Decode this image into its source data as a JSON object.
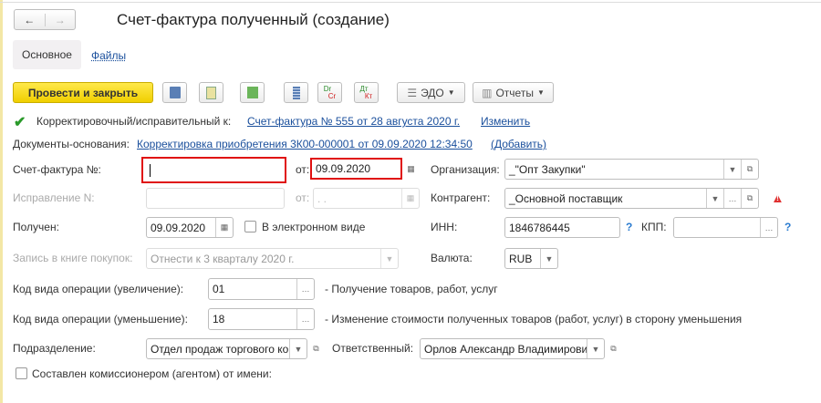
{
  "window": {
    "title": "Счет-фактура полученный (создание)"
  },
  "nav": {
    "back": "←",
    "forward": "→"
  },
  "tabs": [
    {
      "label": "Основное",
      "active": true
    },
    {
      "label": "Файлы",
      "active": false
    }
  ],
  "toolbar": {
    "post_close": "Провести и закрыть",
    "edo": "ЭДО",
    "reports": "Отчеты",
    "dr": "Dr",
    "cr": "Cr",
    "dt": "Дт",
    "kt": "Кт",
    "accent": "#f5d800"
  },
  "correction": {
    "checked": true,
    "label": "Корректировочный/исправительный к:",
    "link": "Счет-фактура № 555 от 28 августа 2020 г.",
    "change": "Изменить"
  },
  "base_docs": {
    "label": "Документы-основания:",
    "link": "Корректировка приобретения 3К00-000001 от 09.09.2020 12:34:50",
    "add": "(Добавить)"
  },
  "form": {
    "invoice_no": {
      "label": "Счет-фактура №:",
      "value": ""
    },
    "invoice_date": {
      "label": "от:",
      "value": "09.09.2020"
    },
    "fix_no": {
      "label": "Исправление N:",
      "value": ""
    },
    "fix_date": {
      "label": "от:",
      "value": " .  .  "
    },
    "received": {
      "label": "Получен:",
      "value": "09.09.2020"
    },
    "electronic": {
      "label": "В электронном виде",
      "checked": false
    },
    "purchase_book": {
      "label": "Запись в книге покупок:",
      "value": "Отнести к 3 кварталу 2020 г."
    },
    "organization": {
      "label": "Организация:",
      "value": "_\"Опт Закупки\""
    },
    "counterparty": {
      "label": "Контрагент:",
      "value": "_Основной поставщик"
    },
    "inn": {
      "label": "ИНН:",
      "value": "1846786445",
      "help": "?"
    },
    "kpp": {
      "label": "КПП:",
      "value": "",
      "help": "?"
    },
    "currency": {
      "label": "Валюта:",
      "value": "RUB"
    },
    "op_increase": {
      "label": "Код вида операции (увеличение):",
      "value": "01",
      "desc": "- Получение товаров, работ, услуг"
    },
    "op_decrease": {
      "label": "Код вида операции (уменьшение):",
      "value": "18",
      "desc": "- Изменение стоимости полученных товаров (работ, услуг) в сторону уменьшения"
    },
    "department": {
      "label": "Подразделение:",
      "value": "Отдел продаж торгового комплекса"
    },
    "responsible": {
      "label": "Ответственный:",
      "value": "Орлов Александр Владимирович"
    },
    "agent": {
      "label": "Составлен комиссионером (агентом) от имени:",
      "checked": false
    }
  }
}
